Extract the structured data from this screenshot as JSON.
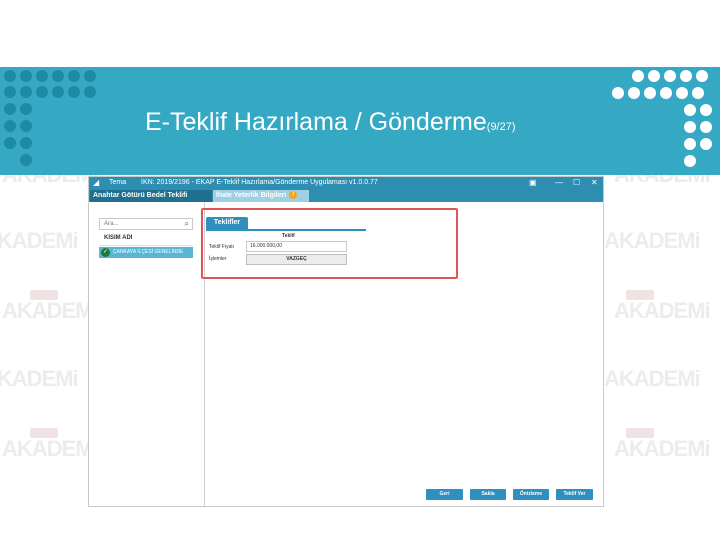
{
  "watermark": {
    "brand_text": "AKADEMi"
  },
  "slide": {
    "title": "E-Teklif Hazırlama /  Gönderme",
    "counter": "(9/27)"
  },
  "window": {
    "menu_label": "Tema",
    "title": "İKN: 2019/2196 - EKAP E-Teklif Hazırlama/Gönderme Uygulaması v1.0.0.77",
    "controls": {
      "minimize": "—",
      "maximize": "☐",
      "close": "✕"
    },
    "tabs": [
      {
        "label": "Anahtar Götürü Bedel Teklifi",
        "active": true
      },
      {
        "label": "İhale Yeterlik Bilgileri",
        "active": false,
        "badge": "!"
      }
    ]
  },
  "sidebar": {
    "search_placeholder": "Ara...",
    "column_header": "KISIM ADI",
    "items": [
      {
        "label": "ÇANKAYA İLÇESİ GENELİNDE",
        "status": "check"
      }
    ]
  },
  "offers": {
    "section_tab": "Teklifler",
    "column_title": "Teklif",
    "rows": [
      {
        "label": "Teklif Fiyatı",
        "value": "16.000.000,00"
      },
      {
        "label": "İşlemler",
        "button": "VAZGEÇ"
      }
    ]
  },
  "footer_buttons": [
    {
      "label": "Geri"
    },
    {
      "label": "Sakla"
    },
    {
      "label": "Önizleme"
    },
    {
      "label": "Teklif Ver"
    }
  ],
  "colors": {
    "banner": "#35a9c4",
    "window_titlebar": "#2d8eb2",
    "button": "#2f8fbf",
    "highlight": "#e05555"
  }
}
